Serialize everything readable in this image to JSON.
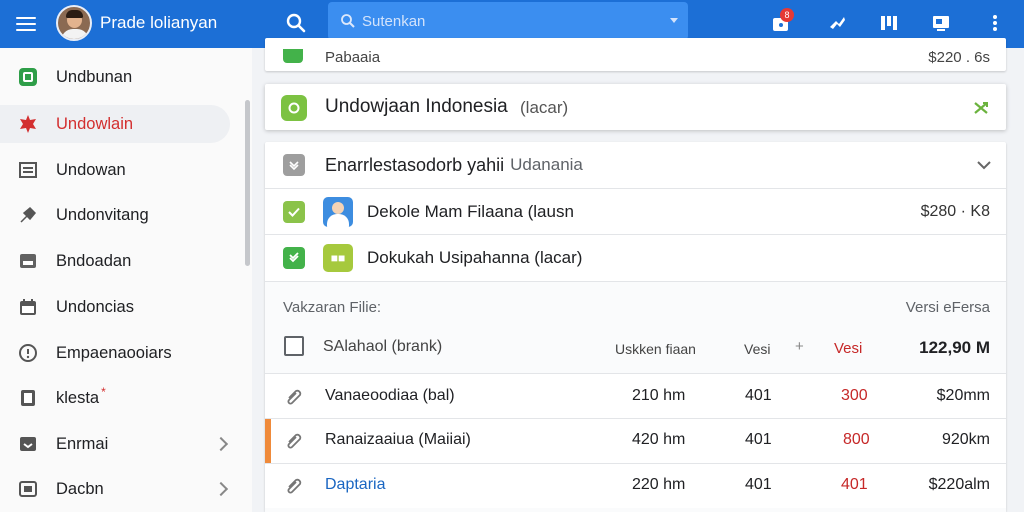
{
  "header": {
    "app_title": "Prade lolianyan",
    "search_placeholder": "Sutenkan",
    "notification_count": "8",
    "menu_icon": "hamburger-icon",
    "search_icon": "search-icon",
    "icons": [
      "notification-icon",
      "puzzle-icon",
      "columns-icon",
      "window-icon",
      "more-vert-icon"
    ]
  },
  "sidebar": {
    "items": [
      {
        "label": "Undbunan",
        "icon": "square-green-icon"
      },
      {
        "label": "Undowlain",
        "icon": "star-burst-icon"
      },
      {
        "label": "Undowan",
        "icon": "list-icon"
      },
      {
        "label": "Undonvitang",
        "icon": "pin-icon"
      },
      {
        "label": "Bndoadan",
        "icon": "disk-icon"
      },
      {
        "label": "Undoncias",
        "icon": "calendar-icon"
      },
      {
        "label": "Empaenaooiars",
        "icon": "info-icon"
      },
      {
        "label": "klesta",
        "icon": "doc-icon",
        "marker": "*"
      },
      {
        "label": "Enrmai",
        "icon": "inbox-icon"
      },
      {
        "label": "Dacbn",
        "icon": "box-icon"
      }
    ]
  },
  "main": {
    "partial_row": {
      "title": "Pabaaia",
      "value": "$220 . 6s"
    },
    "selected_card": {
      "title": "Undowjaan Indonesia",
      "suffix": "(lacar)"
    },
    "group": {
      "header_bold": "Enarrlestasodorb yahii",
      "header_tail": "Udanania",
      "items": [
        {
          "title": "Dekole Mam Filaana (lausn",
          "value": "$280 · K8"
        },
        {
          "title": "Dokukah Usipahanna (lacar)",
          "value": ""
        }
      ]
    },
    "files": {
      "section_label": "Vakzaran Filie:",
      "version_label": "Versi eFersa",
      "columns": {
        "name": "SAlahaol (brank)",
        "size": "Uskken fiaan",
        "version": "Vesi",
        "plus": "+",
        "ver2": "Vesi",
        "total": "122,90 M"
      },
      "rows": [
        {
          "name": "Vanaeoodiaa (bal)",
          "size": "210 hm",
          "ver": "401",
          "red": "300",
          "amount": "$20mm"
        },
        {
          "name": "Ranaizaaiua (Maiiai)",
          "size": "420 hm",
          "ver": "401",
          "red": "800",
          "amount": "920km"
        },
        {
          "name": "Daptaria",
          "size": "220 hm",
          "ver": "401",
          "red": "401",
          "amount": "$220alm"
        }
      ]
    }
  },
  "colors": {
    "brand": "#1c6fd6",
    "accent_red": "#d32f2f",
    "green": "#43b24a"
  }
}
